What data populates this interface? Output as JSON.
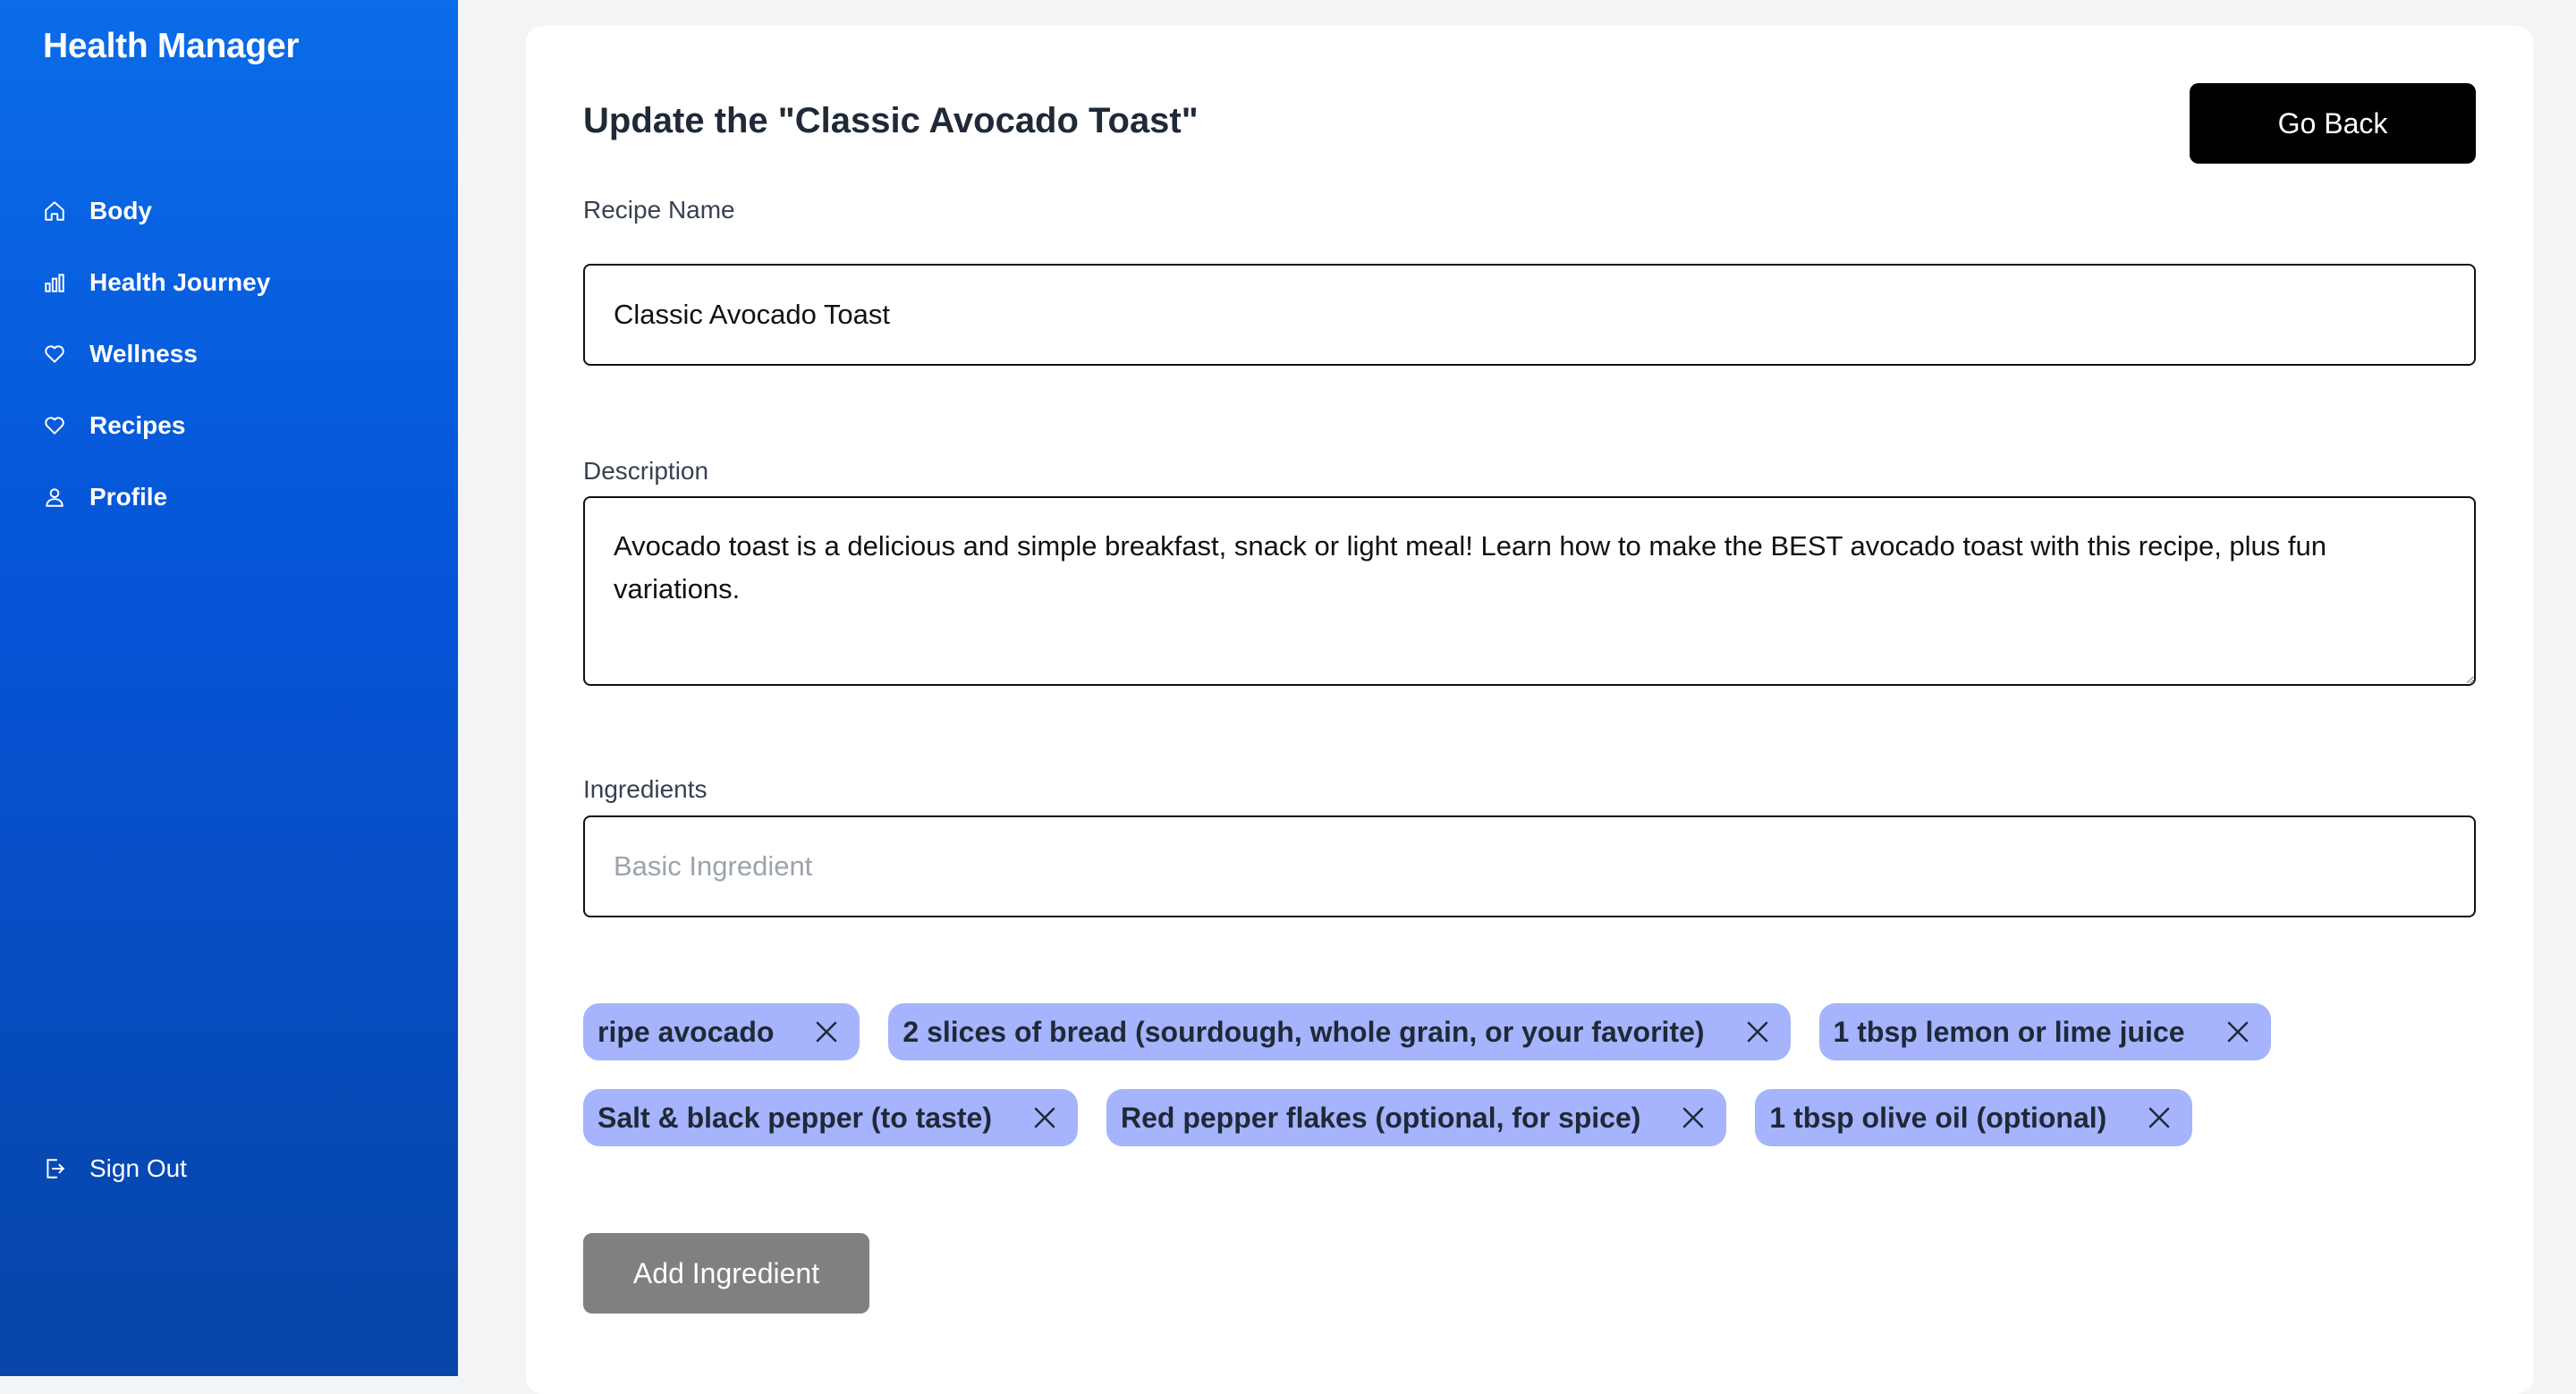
{
  "app": {
    "title": "Health Manager"
  },
  "sidebar": {
    "items": [
      {
        "label": "Body",
        "icon": "home-icon"
      },
      {
        "label": "Health Journey",
        "icon": "bar-chart-icon"
      },
      {
        "label": "Wellness",
        "icon": "heart-icon"
      },
      {
        "label": "Recipes",
        "icon": "heart-icon"
      },
      {
        "label": "Profile",
        "icon": "user-icon"
      }
    ],
    "signout": {
      "label": "Sign Out",
      "icon": "sign-out-icon"
    }
  },
  "page": {
    "title": "Update the \"Classic Avocado Toast\"",
    "go_back_label": "Go Back"
  },
  "form": {
    "recipe_name": {
      "label": "Recipe Name",
      "value": "Classic Avocado Toast"
    },
    "description": {
      "label": "Description",
      "value": "Avocado toast is a delicious and simple breakfast, snack or light meal! Learn how to make the BEST avocado toast with this recipe, plus fun variations."
    },
    "ingredients": {
      "label": "Ingredients",
      "placeholder": "Basic Ingredient",
      "items": [
        "ripe avocado",
        "2 slices of bread (sourdough, whole grain, or your favorite)",
        "1 tbsp lemon or lime juice",
        "Salt & black pepper (to taste)",
        "Red pepper flakes (optional, for spice)",
        "1 tbsp olive oil (optional)"
      ]
    },
    "add_ingredient_label": "Add Ingredient"
  },
  "colors": {
    "sidebar_top": "#0a6ce8",
    "sidebar_bottom": "#0745a7",
    "chip_bg": "#a5b4fc",
    "go_back_bg": "#000000",
    "add_button_bg": "#808080"
  }
}
